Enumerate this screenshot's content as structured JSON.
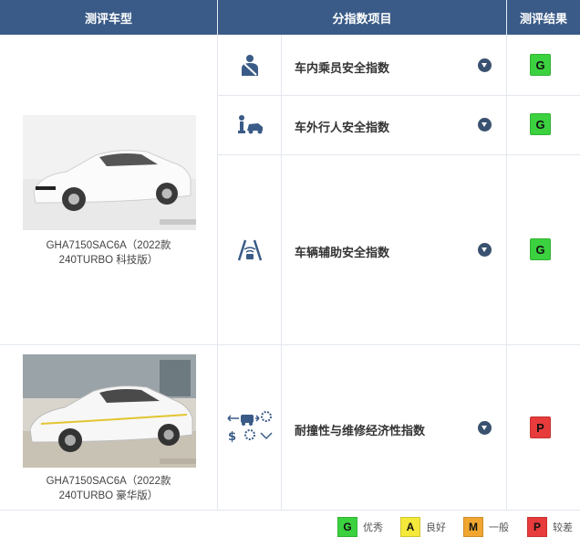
{
  "colors": {
    "header_bg": "#3a5b87",
    "grade_G": "#3bd13f",
    "grade_A": "#f4e83a",
    "grade_M": "#f0a630",
    "grade_P": "#e83b3b"
  },
  "header": {
    "col_vehicle": "测评车型",
    "col_index": "分指数项目",
    "col_result": "测评结果"
  },
  "vehicles": [
    {
      "caption_line1": "GHA7150SAC6A（2022款",
      "caption_line2": "240TURBO 科技版）"
    },
    {
      "caption_line1": "GHA7150SAC6A（2022款",
      "caption_line2": "240TURBO 豪华版）"
    }
  ],
  "indices": [
    {
      "label": "车内乘员安全指数",
      "icon": "seatbelt-passenger-icon",
      "grade": "G"
    },
    {
      "label": "车外行人安全指数",
      "icon": "pedestrian-car-icon",
      "grade": "G"
    },
    {
      "label": "车辆辅助安全指数",
      "icon": "driver-assist-icon",
      "grade": "G"
    },
    {
      "label": "耐撞性与维修经济性指数",
      "icon": "repair-cost-icon",
      "grade": "P"
    }
  ],
  "legend": [
    {
      "grade": "G",
      "label": "优秀"
    },
    {
      "grade": "A",
      "label": "良好"
    },
    {
      "grade": "M",
      "label": "一般"
    },
    {
      "grade": "P",
      "label": "较差"
    }
  ]
}
